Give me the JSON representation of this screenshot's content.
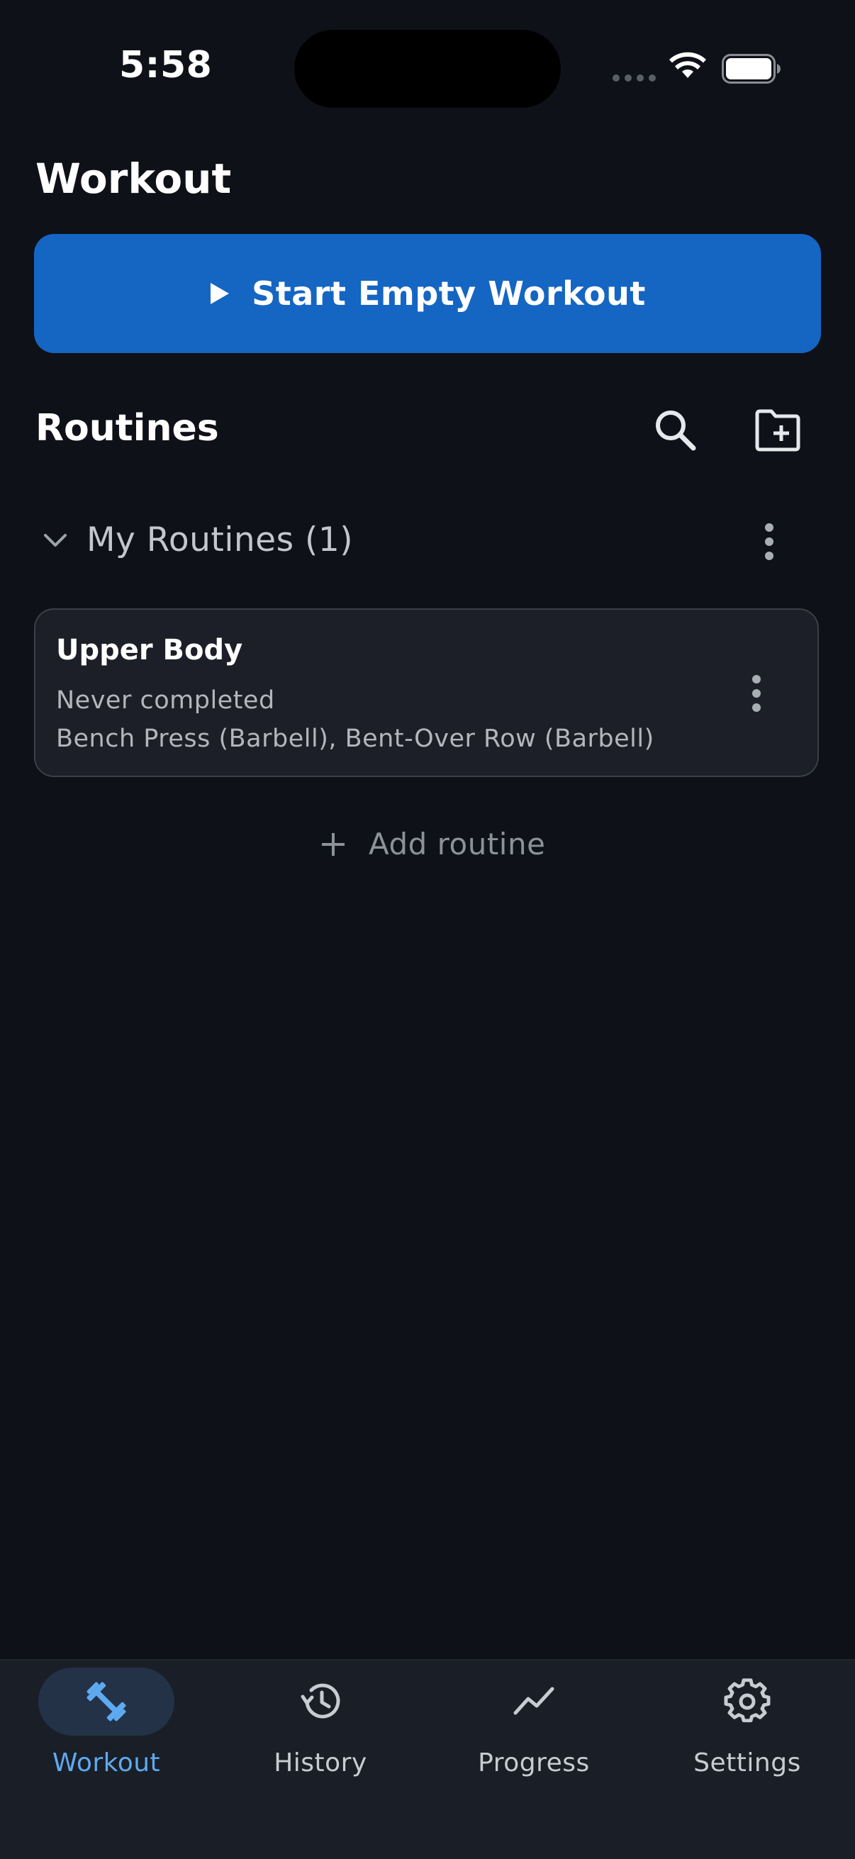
{
  "status_bar": {
    "time": "5:58"
  },
  "page": {
    "title": "Workout"
  },
  "start_button": {
    "label": "Start Empty Workout",
    "icon": "play-icon"
  },
  "routines": {
    "title": "Routines",
    "actions": [
      {
        "icon": "search-icon"
      },
      {
        "icon": "folder-add-icon"
      }
    ],
    "group": {
      "title": "My Routines (1)",
      "expanded": true
    },
    "items": [
      {
        "name": "Upper Body",
        "last_completed": "Never completed",
        "exercises": "Bench Press (Barbell), Bent-Over Row (Barbell)"
      }
    ],
    "add_label": "Add routine"
  },
  "bottom_nav": {
    "items": [
      {
        "label": "Workout",
        "icon": "dumbbell-icon",
        "active": true
      },
      {
        "label": "History",
        "icon": "history-icon",
        "active": false
      },
      {
        "label": "Progress",
        "icon": "trend-icon",
        "active": false
      },
      {
        "label": "Settings",
        "icon": "gear-icon",
        "active": false
      }
    ]
  },
  "colors": {
    "background": "#0e1118",
    "primary_button": "#1565c3",
    "card": "#1c1f27",
    "nav_active": "#5eaaf0"
  }
}
